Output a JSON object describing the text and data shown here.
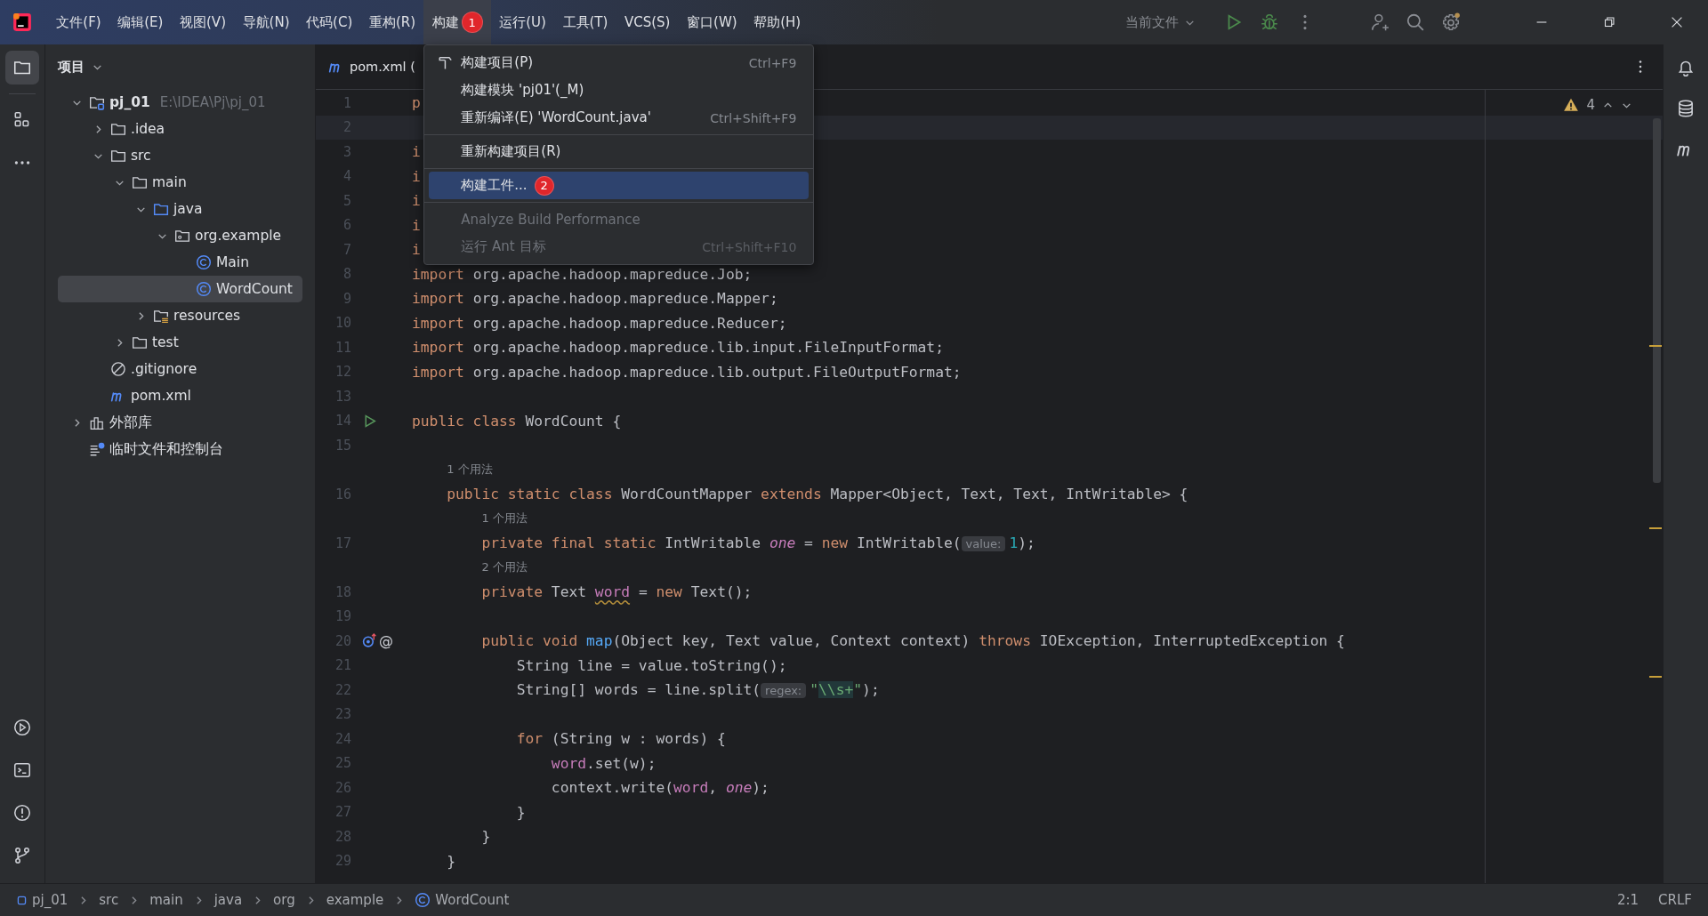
{
  "title_bar": {
    "menus": [
      {
        "label": "文件(F)",
        "selected": false
      },
      {
        "label": "编辑(E)",
        "selected": false
      },
      {
        "label": "视图(V)",
        "selected": false
      },
      {
        "label": "导航(N)",
        "selected": false
      },
      {
        "label": "代码(C)",
        "selected": false
      },
      {
        "label": "重构(R)",
        "selected": false
      },
      {
        "label": "构建",
        "selected": true,
        "badge": "1",
        "dropdown": {
          "groups": [
            [
              {
                "label": "构建项目(P)",
                "shortcut": "Ctrl+F9",
                "disabled": false,
                "selected": false
              },
              {
                "label": "构建模块 'pj01'(_M)",
                "disabled": false,
                "selected": false
              },
              {
                "label": "重新编译(E) 'WordCount.java'",
                "shortcut": "Ctrl+Shift+F9",
                "disabled": false,
                "selected": false
              }
            ],
            [
              {
                "label": "重新构建项目(R)",
                "disabled": false,
                "selected": false
              }
            ],
            [
              {
                "label": "构建工件...",
                "disabled": false,
                "selected": true,
                "badge": "2"
              }
            ],
            [
              {
                "label": "Analyze Build Performance",
                "disabled": true,
                "selected": false
              },
              {
                "label": "运行 Ant 目标",
                "shortcut": "Ctrl+Shift+F10",
                "disabled": true,
                "selected": false
              }
            ]
          ]
        }
      },
      {
        "label": "运行(U)",
        "selected": false
      },
      {
        "label": "工具(T)",
        "selected": false
      },
      {
        "label": "VCS(S)",
        "selected": false
      },
      {
        "label": "窗口(W)",
        "selected": false
      },
      {
        "label": "帮助(H)",
        "selected": false
      }
    ],
    "run_config": "当前文件"
  },
  "left_tools": {
    "top": [
      {
        "kind": "project",
        "selected": true
      },
      {
        "kind": "structure",
        "selected": false
      },
      {
        "kind": "more",
        "selected": false
      }
    ],
    "bottom": [
      {
        "kind": "run",
        "selected": false
      },
      {
        "kind": "terminal",
        "selected": false
      },
      {
        "kind": "problems",
        "selected": false
      },
      {
        "kind": "git",
        "selected": false
      }
    ]
  },
  "right_tools": [
    {
      "kind": "notifications",
      "selected": false
    },
    {
      "kind": "database",
      "selected": false
    },
    {
      "kind": "maven",
      "selected": false
    }
  ],
  "project_panel": {
    "title": "项目",
    "tree": [
      {
        "label": "pj_01",
        "kind": "project",
        "hint": "E:\\IDEA\\Pj\\pj_01",
        "expanded": true,
        "selected": false,
        "children": [
          {
            "label": ".idea",
            "kind": "folder",
            "expanded": false,
            "selected": false
          },
          {
            "label": "src",
            "kind": "folder",
            "expanded": true,
            "selected": false,
            "children": [
              {
                "label": "main",
                "kind": "folder",
                "expanded": true,
                "selected": false,
                "children": [
                  {
                    "label": "java",
                    "kind": "source",
                    "expanded": true,
                    "selected": false,
                    "children": [
                      {
                        "label": "org.example",
                        "kind": "package",
                        "expanded": true,
                        "selected": false,
                        "children": [
                          {
                            "label": "Main",
                            "kind": "class",
                            "selected": false
                          },
                          {
                            "label": "WordCount",
                            "kind": "class",
                            "selected": true
                          }
                        ]
                      }
                    ]
                  },
                  {
                    "label": "resources",
                    "kind": "resources",
                    "expanded": false,
                    "selected": false
                  }
                ]
              },
              {
                "label": "test",
                "kind": "folder",
                "expanded": false,
                "selected": false
              }
            ]
          },
          {
            "label": ".gitignore",
            "kind": "ignore",
            "selected": false
          },
          {
            "label": "pom.xml",
            "kind": "maven",
            "selected": false
          }
        ]
      },
      {
        "label": "外部库",
        "kind": "library",
        "expanded": false,
        "selected": false
      },
      {
        "label": "临时文件和控制台",
        "kind": "scratch",
        "selected": false
      }
    ]
  },
  "editor": {
    "tab": {
      "label": "pom.xml (",
      "kind": "maven"
    },
    "warnings": "4",
    "lines": [
      {
        "number": "1",
        "current": false,
        "tokens": [
          {
            "text": "p",
            "kind": "kw"
          }
        ]
      },
      {
        "number": "2",
        "current": true
      },
      {
        "number": "3",
        "current": false,
        "tokens": [
          {
            "text": "i",
            "kind": "kw"
          }
        ]
      },
      {
        "number": "4",
        "current": false,
        "tokens": [
          {
            "text": "i",
            "kind": "kw"
          }
        ]
      },
      {
        "number": "5",
        "current": false,
        "tokens": [
          {
            "text": "i",
            "kind": "kw"
          }
        ]
      },
      {
        "number": "6",
        "current": false,
        "tokens": [
          {
            "text": "i",
            "kind": "kw"
          }
        ]
      },
      {
        "number": "7",
        "current": false,
        "tokens": [
          {
            "text": "i",
            "kind": "kw"
          }
        ]
      },
      {
        "number": "8",
        "current": false,
        "tokens": [
          {
            "text": "import",
            "kind": "kw"
          },
          {
            "text": " org.apache.hadoop.mapreduce.Job;",
            "kind": "plain"
          }
        ]
      },
      {
        "number": "9",
        "current": false,
        "tokens": [
          {
            "text": "import",
            "kind": "kw"
          },
          {
            "text": " org.apache.hadoop.mapreduce.Mapper;",
            "kind": "plain"
          }
        ]
      },
      {
        "number": "10",
        "current": false,
        "tokens": [
          {
            "text": "import",
            "kind": "kw"
          },
          {
            "text": " org.apache.hadoop.mapreduce.Reducer;",
            "kind": "plain"
          }
        ]
      },
      {
        "number": "11",
        "current": false,
        "tokens": [
          {
            "text": "import",
            "kind": "kw"
          },
          {
            "text": " org.apache.hadoop.mapreduce.lib.input.FileInputFormat;",
            "kind": "plain"
          }
        ]
      },
      {
        "number": "12",
        "current": false,
        "tokens": [
          {
            "text": "import",
            "kind": "kw"
          },
          {
            "text": " org.apache.hadoop.mapreduce.lib.output.FileOutputFormat;",
            "kind": "plain"
          }
        ]
      },
      {
        "number": "13",
        "current": false
      },
      {
        "number": "14",
        "current": false,
        "gutter": [
          {
            "kind": "run"
          }
        ],
        "tokens": [
          {
            "text": "public class",
            "kind": "kw"
          },
          {
            "text": " WordCount {",
            "kind": "plain"
          }
        ],
        "children": [
          {
            "number": "15",
            "current": false
          },
          {
            "current": false,
            "tokens": [
              {
                "text": "1 个用法",
                "kind": "usage"
              }
            ]
          },
          {
            "number": "16",
            "current": false,
            "tokens": [
              {
                "text": "public static class",
                "kind": "kw"
              },
              {
                "text": " WordCountMapper ",
                "kind": "plain"
              },
              {
                "text": "extends",
                "kind": "kw"
              },
              {
                "text": " Mapper<Object, Text, Text, IntWritable> {",
                "kind": "plain"
              }
            ],
            "children": [
              {
                "current": false,
                "tokens": [
                  {
                    "text": "1 个用法",
                    "kind": "usage"
                  }
                ]
              },
              {
                "number": "17",
                "current": false,
                "tokens": [
                  {
                    "text": "private final static",
                    "kind": "kw"
                  },
                  {
                    "text": " IntWritable ",
                    "kind": "plain"
                  },
                  {
                    "text": "one",
                    "kind": "field_italic"
                  },
                  {
                    "text": " = ",
                    "kind": "plain"
                  },
                  {
                    "text": "new",
                    "kind": "kw"
                  },
                  {
                    "text": " IntWritable(",
                    "kind": "plain"
                  },
                  {
                    "text": "value:",
                    "kind": "hint"
                  },
                  {
                    "text": "1",
                    "kind": "num"
                  },
                  {
                    "text": ");",
                    "kind": "plain"
                  }
                ]
              },
              {
                "current": false,
                "tokens": [
                  {
                    "text": "2 个用法",
                    "kind": "usage"
                  }
                ]
              },
              {
                "number": "18",
                "current": false,
                "tokens": [
                  {
                    "text": "private",
                    "kind": "kw"
                  },
                  {
                    "text": " Text ",
                    "kind": "plain"
                  },
                  {
                    "text": "word",
                    "kind": "field_warn"
                  },
                  {
                    "text": " = ",
                    "kind": "plain"
                  },
                  {
                    "text": "new",
                    "kind": "kw"
                  },
                  {
                    "text": " Text();",
                    "kind": "plain"
                  }
                ]
              },
              {
                "number": "19",
                "current": false
              },
              {
                "number": "20",
                "current": false,
                "gutter": [
                  {
                    "kind": "override"
                  },
                  {
                    "kind": "glyph",
                    "text": "@"
                  }
                ],
                "tokens": [
                  {
                    "text": "public void",
                    "kind": "kw"
                  },
                  {
                    "text": " map",
                    "kind": "fn"
                  },
                  {
                    "text": "(Object key, Text value, Context context) ",
                    "kind": "plain"
                  },
                  {
                    "text": "throws",
                    "kind": "kw"
                  },
                  {
                    "text": " IOException, InterruptedException {",
                    "kind": "plain"
                  }
                ],
                "children": [
                  {
                    "number": "21",
                    "current": false,
                    "tokens": [
                      {
                        "text": "String line = value.toString();",
                        "kind": "plain"
                      }
                    ]
                  },
                  {
                    "number": "22",
                    "current": false,
                    "tokens": [
                      {
                        "text": "String[] words = line.split(",
                        "kind": "plain"
                      },
                      {
                        "text": "regex:",
                        "kind": "hint"
                      },
                      {
                        "text": "\"",
                        "kind": "str"
                      },
                      {
                        "text": "\\\\s+",
                        "kind": "regex"
                      },
                      {
                        "text": "\"",
                        "kind": "str"
                      },
                      {
                        "text": ");",
                        "kind": "plain"
                      }
                    ]
                  },
                  {
                    "number": "23",
                    "current": false
                  },
                  {
                    "number": "24",
                    "current": false,
                    "tokens": [
                      {
                        "text": "for",
                        "kind": "kw"
                      },
                      {
                        "text": " (String w : words) {",
                        "kind": "plain"
                      }
                    ],
                    "children": [
                      {
                        "number": "25",
                        "current": false,
                        "tokens": [
                          {
                            "text": "word",
                            "kind": "field"
                          },
                          {
                            "text": ".set(w);",
                            "kind": "plain"
                          }
                        ]
                      },
                      {
                        "number": "26",
                        "current": false,
                        "tokens": [
                          {
                            "text": "context.write(",
                            "kind": "plain"
                          },
                          {
                            "text": "word",
                            "kind": "field"
                          },
                          {
                            "text": ", ",
                            "kind": "plain"
                          },
                          {
                            "text": "one",
                            "kind": "field_italic"
                          },
                          {
                            "text": ");",
                            "kind": "plain"
                          }
                        ]
                      }
                    ]
                  },
                  {
                    "number": "27",
                    "current": false,
                    "tokens": [
                      {
                        "text": "}",
                        "kind": "plain"
                      }
                    ]
                  }
                ]
              },
              {
                "number": "28",
                "current": false,
                "tokens": [
                  {
                    "text": "}",
                    "kind": "plain"
                  }
                ]
              }
            ]
          },
          {
            "number": "29",
            "current": false,
            "tokens": [
              {
                "text": "}",
                "kind": "plain"
              }
            ]
          }
        ]
      }
    ]
  },
  "status_bar": {
    "breadcrumbs": [
      {
        "label": "pj_01",
        "kind": "module"
      },
      {
        "label": "src",
        "kind": "plain"
      },
      {
        "label": "main",
        "kind": "plain"
      },
      {
        "label": "java",
        "kind": "plain"
      },
      {
        "label": "org",
        "kind": "plain"
      },
      {
        "label": "example",
        "kind": "plain"
      },
      {
        "label": "WordCount",
        "kind": "class"
      }
    ],
    "position": "2:1",
    "line_separator": "CRLF"
  }
}
